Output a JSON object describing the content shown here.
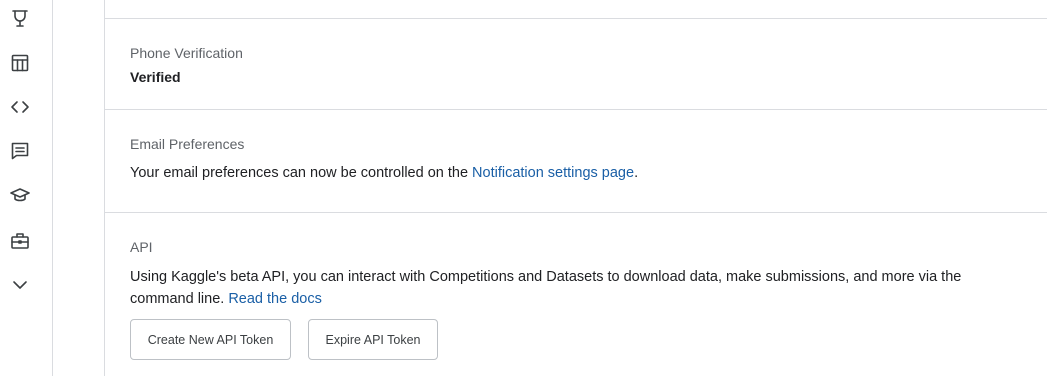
{
  "sidebar": {
    "icons": [
      {
        "name": "trophy-icon"
      },
      {
        "name": "table-icon"
      },
      {
        "name": "code-icon"
      },
      {
        "name": "discussion-icon"
      },
      {
        "name": "school-icon"
      },
      {
        "name": "briefcase-icon"
      },
      {
        "name": "chevron-down-icon"
      }
    ]
  },
  "phone": {
    "title": "Phone Verification",
    "value": "Verified"
  },
  "email": {
    "title": "Email Preferences",
    "text": "Your email preferences can now be controlled on the ",
    "link": "Notification settings page",
    "suffix": "."
  },
  "api": {
    "title": "API",
    "text_line1": "Using Kaggle's beta API, you can interact with Competitions and Datasets to download data, make submissions, and more via the",
    "text_line2": "command line. ",
    "link": "Read the docs",
    "create_button": "Create New API Token",
    "expire_button": "Expire API Token"
  },
  "colors": {
    "link": "#1a5fa6",
    "border": "#dadce0",
    "muted_text": "#5f6368"
  }
}
